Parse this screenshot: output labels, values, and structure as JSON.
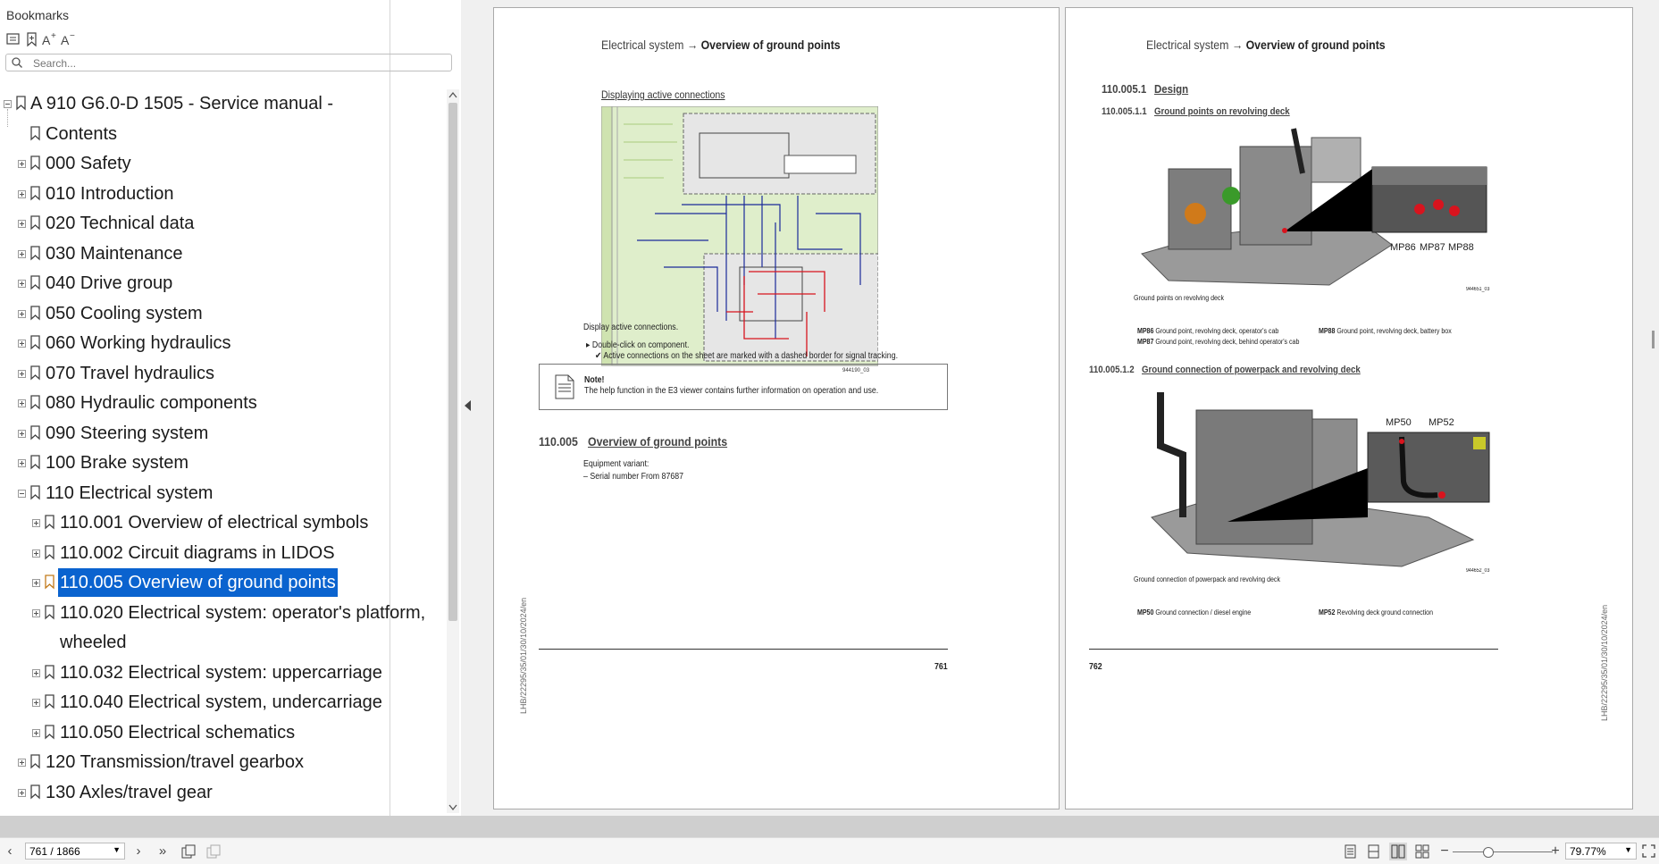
{
  "sidebar": {
    "title": "Bookmarks",
    "search_placeholder": "Search...",
    "tree": [
      {
        "label": "A 910 G6.0-D 1505 - Service manual -",
        "expander": "minus",
        "level": 0
      },
      {
        "label": "Contents",
        "expander": "none",
        "level": 1
      },
      {
        "label": "000 Safety",
        "expander": "plus",
        "level": 1
      },
      {
        "label": "010 Introduction",
        "expander": "plus",
        "level": 1
      },
      {
        "label": "020 Technical data",
        "expander": "plus",
        "level": 1
      },
      {
        "label": "030 Maintenance",
        "expander": "plus",
        "level": 1
      },
      {
        "label": "040 Drive group",
        "expander": "plus",
        "level": 1
      },
      {
        "label": "050 Cooling system",
        "expander": "plus",
        "level": 1
      },
      {
        "label": "060 Working hydraulics",
        "expander": "plus",
        "level": 1
      },
      {
        "label": "070 Travel hydraulics",
        "expander": "plus",
        "level": 1
      },
      {
        "label": "080 Hydraulic components",
        "expander": "plus",
        "level": 1
      },
      {
        "label": "090 Steering system",
        "expander": "plus",
        "level": 1
      },
      {
        "label": "100 Brake system",
        "expander": "plus",
        "level": 1
      },
      {
        "label": "110 Electrical system",
        "expander": "minus",
        "level": 1
      },
      {
        "label": "110.001 Overview of electrical symbols",
        "expander": "plus",
        "level": 2
      },
      {
        "label": "110.002 Circuit diagrams in LIDOS",
        "expander": "plus",
        "level": 2
      },
      {
        "label": "110.005 Overview of ground points",
        "expander": "plus",
        "level": 2,
        "selected": true
      },
      {
        "label": "110.020 Electrical system: operator's platform,",
        "label2": "wheeled",
        "expander": "plus",
        "level": 2
      },
      {
        "label": "110.032 Electrical system: uppercarriage",
        "expander": "plus",
        "level": 2
      },
      {
        "label": "110.040 Electrical system, undercarriage",
        "expander": "plus",
        "level": 2
      },
      {
        "label": "110.050 Electrical schematics",
        "expander": "plus",
        "level": 2
      },
      {
        "label": "120 Transmission/travel gearbox",
        "expander": "plus",
        "level": 1
      },
      {
        "label": "130 Axles/travel gear",
        "expander": "plus",
        "level": 1
      }
    ]
  },
  "page_left": {
    "header_prefix": "Electrical system",
    "header_arrow": "→",
    "header_title": "Overview of ground points",
    "subheading": "Displaying active connections",
    "figure_id": "944190_03",
    "caption": "Display active connections.",
    "step": "Double-click on component.",
    "result": "Active connections on the sheet are marked with a dashed border for signal tracking.",
    "note_title": "Note!",
    "note_text": "The help function in the E3 viewer contains further information on operation and use.",
    "section_number": "110.005",
    "section_title": "Overview of ground points",
    "equipment_label": "Equipment variant:",
    "serial_text": "Serial number From 87687",
    "side_text": "LHB/22295/35/01/30/10/2024/en",
    "page_number": "761"
  },
  "page_right": {
    "header_prefix": "Electrical system",
    "header_arrow": "→",
    "header_title": "Overview of ground points",
    "sec1_number": "110.005.1",
    "sec1_title": "Design",
    "sec2_number": "110.005.1.1",
    "sec2_title": "Ground points on revolving deck",
    "fig1_caption": "Ground points on revolving deck",
    "fig1_id": "944651_03",
    "fig1_labels": [
      "MP86",
      "MP87",
      "MP88"
    ],
    "legend1": [
      {
        "code": "MP86",
        "text": "Ground point, revolving deck, operator's cab"
      },
      {
        "code": "MP87",
        "text": "Ground point, revolving deck, behind operator's cab"
      },
      {
        "code": "MP88",
        "text": "Ground point, revolving deck, battery box"
      }
    ],
    "sec3_number": "110.005.1.2",
    "sec3_title": "Ground connection of powerpack and revolving deck",
    "fig2_labels": [
      "MP50",
      "MP52"
    ],
    "fig2_caption": "Ground connection of powerpack and revolving deck",
    "fig2_id": "944652_03",
    "legend2": [
      {
        "code": "MP50",
        "text": "Ground connection / diesel engine"
      },
      {
        "code": "MP52",
        "text": "Revolving deck ground connection"
      }
    ],
    "side_text": "LHB/22295/35/01/30/10/2024/en",
    "page_number": "762"
  },
  "status_bar": {
    "page_value": "761 / 1866",
    "zoom_value": "79.77%"
  },
  "colors": {
    "selection": "#0a63cf",
    "diagram_bg": "#dfeecb",
    "ground_point_red": "#d8141e"
  },
  "icons": [
    "collapse-all-icon",
    "bookmark-add-icon",
    "font-increase-icon",
    "font-decrease-icon",
    "search-icon",
    "bookmark-icon",
    "prev-page-icon",
    "next-page-icon",
    "last-page-icon",
    "single-page-icon",
    "continuous-icon",
    "two-page-icon",
    "grid-icon",
    "zoom-out-icon",
    "zoom-in-icon",
    "fullscreen-icon"
  ]
}
